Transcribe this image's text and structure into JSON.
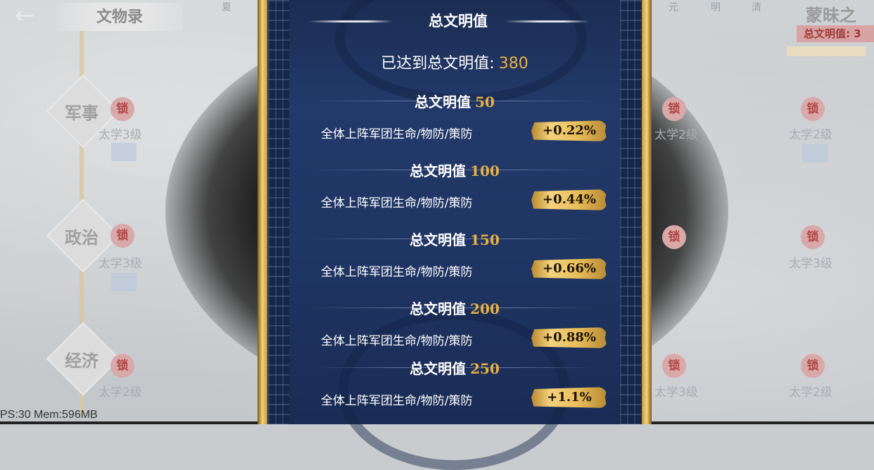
{
  "background": {
    "back_icon": "back-arrow-icon",
    "page_title": "文物录",
    "eras": [
      "夏",
      "元",
      "明",
      "清"
    ],
    "categories": [
      {
        "label": "军事",
        "lock_left": "锁",
        "level_left": "太学3级"
      },
      {
        "label": "政治",
        "lock_left": "锁",
        "level_left": "太学3级"
      },
      {
        "label": "经济",
        "lock_left": "锁",
        "level_left": "太学2级"
      }
    ],
    "right_column": [
      {
        "lock": "锁",
        "level": "太学2级",
        "lock_far": "锁",
        "level_far": "太学2级"
      },
      {
        "lock": "锁",
        "level": "",
        "lock_far": "锁",
        "level_far": "太学3级"
      },
      {
        "lock": "锁",
        "level": "太学3级",
        "lock_far": "锁",
        "level_far": "太学2级"
      }
    ],
    "right_title": "蒙昧之",
    "right_subtitle": "总文明值: 3",
    "fps_text": "PS:30 Mem:596MB"
  },
  "panel": {
    "title": "总文明值",
    "reached_label": "已达到总文明值:",
    "reached_value": "380",
    "tiers": [
      {
        "label": "总文明值",
        "threshold": "50",
        "desc": "全体上阵军团生命/物防/策防",
        "bonus": "+0.22%"
      },
      {
        "label": "总文明值",
        "threshold": "100",
        "desc": "全体上阵军团生命/物防/策防",
        "bonus": "+0.44%"
      },
      {
        "label": "总文明值",
        "threshold": "150",
        "desc": "全体上阵军团生命/物防/策防",
        "bonus": "+0.66%"
      },
      {
        "label": "总文明值",
        "threshold": "200",
        "desc": "全体上阵军团生命/物防/策防",
        "bonus": "+0.88%"
      },
      {
        "label": "总文明值",
        "threshold": "250",
        "desc": "全体上阵军团生命/物防/策防",
        "bonus": "+1.1%"
      }
    ]
  },
  "colors": {
    "accent_gold": "#e8b045",
    "panel_blue": "#22396a",
    "lock_red": "#b04848"
  }
}
